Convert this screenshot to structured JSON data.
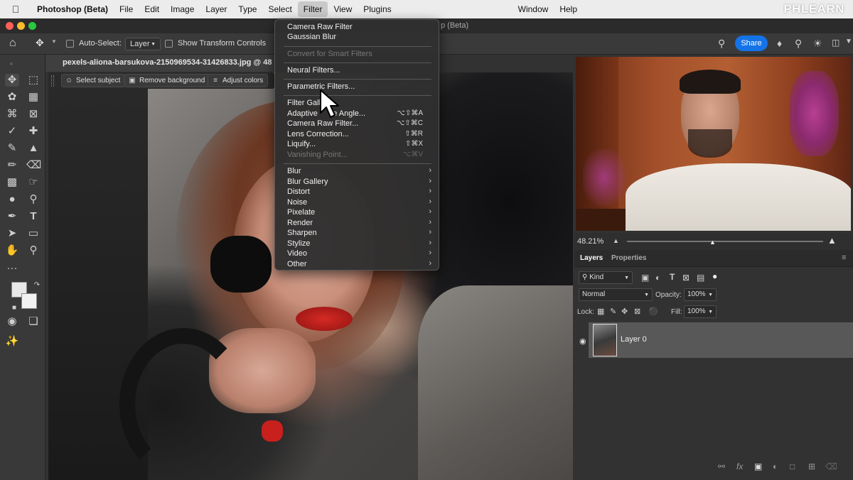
{
  "menubar": {
    "app_name": "Photoshop (Beta)",
    "items": [
      "File",
      "Edit",
      "Image",
      "Layer",
      "Type",
      "Select",
      "Filter",
      "View",
      "Plugins"
    ],
    "right_items": [
      "Window",
      "Help"
    ],
    "active": "Filter",
    "watermark": "PHLEARN"
  },
  "window": {
    "title_fragment": "p (Beta)"
  },
  "options_bar": {
    "auto_select_label": "Auto-Select:",
    "auto_select_value": "Layer",
    "transform_label": "Show Transform Controls",
    "share_label": "Share"
  },
  "document": {
    "tab_title": "pexels-aliona-barsukova-2150969534-31426833.jpg @ 48"
  },
  "contextual_bar": {
    "buttons": [
      "Select subject",
      "Remove background",
      "Adjust colors"
    ]
  },
  "navigator": {
    "zoom": "48.21%"
  },
  "layers_panel": {
    "tabs": [
      "Layers",
      "Properties"
    ],
    "active_tab": "Layers",
    "kind_label": "Kind",
    "blend_mode": "Normal",
    "opacity_label": "Opacity:",
    "opacity_value": "100%",
    "lock_label": "Lock:",
    "fill_label": "Fill:",
    "fill_value": "100%",
    "layers": [
      {
        "name": "Layer 0",
        "visible": true
      }
    ]
  },
  "filter_menu": {
    "items": [
      {
        "label": "Camera Raw Filter",
        "shortcut": "",
        "disabled": false
      },
      {
        "label": "Gaussian Blur",
        "shortcut": "",
        "disabled": false
      },
      {
        "label": "Convert for Smart Filters",
        "shortcut": "",
        "disabled": true
      },
      {
        "label": "Neural Filters...",
        "shortcut": "",
        "disabled": false
      },
      {
        "label": "Parametric Filters...",
        "shortcut": "",
        "disabled": false
      },
      {
        "label": "Filter Gall",
        "shortcut": "",
        "disabled": false
      },
      {
        "label": "Adaptive       e Angle...",
        "shortcut": "⌥⇧⌘A",
        "disabled": false
      },
      {
        "label": "Camera Raw Filter...",
        "shortcut": "⌥⇧⌘C",
        "disabled": false
      },
      {
        "label": "Lens Correction...",
        "shortcut": "⇧⌘R",
        "disabled": false
      },
      {
        "label": "Liquify...",
        "shortcut": "⇧⌘X",
        "disabled": false
      },
      {
        "label": "Vanishing Point...",
        "shortcut": "⌥⌘V",
        "disabled": true
      }
    ],
    "submenus": [
      "Blur",
      "Blur Gallery",
      "Distort",
      "Noise",
      "Pixelate",
      "Render",
      "Sharpen",
      "Stylize",
      "Video",
      "Other"
    ]
  },
  "icons": {
    "apple": "apple-logo-icon",
    "home": "home-icon",
    "move": "move-tool-icon",
    "share": "share-button",
    "search": "search-icon",
    "bell": "bell-icon",
    "eye": "eye-icon"
  }
}
